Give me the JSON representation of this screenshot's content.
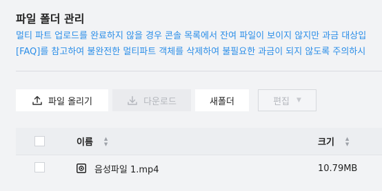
{
  "page": {
    "title": "파일 폴더 관리",
    "desc_line1": "멀티 파트 업로드를 완료하지 않을 경우 콘솔 목록에서 잔여 파일이 보이지 않지만 과금 대상입",
    "desc_line2": "[FAQ]를 참고하여 불완전한 멀티파트 객체를 삭제하여 불필요한 과금이 되지 않도록 주의하시"
  },
  "toolbar": {
    "upload_label": "파일 올리기",
    "download_label": "다운로드",
    "newfolder_label": "새폴더",
    "edit_label": "편집"
  },
  "table": {
    "columns": {
      "name": "이름",
      "size": "크기"
    },
    "rows": [
      {
        "name": "음성파일 1.mp4",
        "size": "10.79MB"
      }
    ]
  },
  "icons": {
    "upload": "upload-icon",
    "download": "download-icon",
    "file": "audio-file-icon",
    "sort": "sort-icon",
    "edit_dropdown": "caret-down-icon"
  },
  "colors": {
    "link_blue": "#2b8ee8",
    "background": "#f2f3f5",
    "disabled_text": "#b4b7bd"
  }
}
